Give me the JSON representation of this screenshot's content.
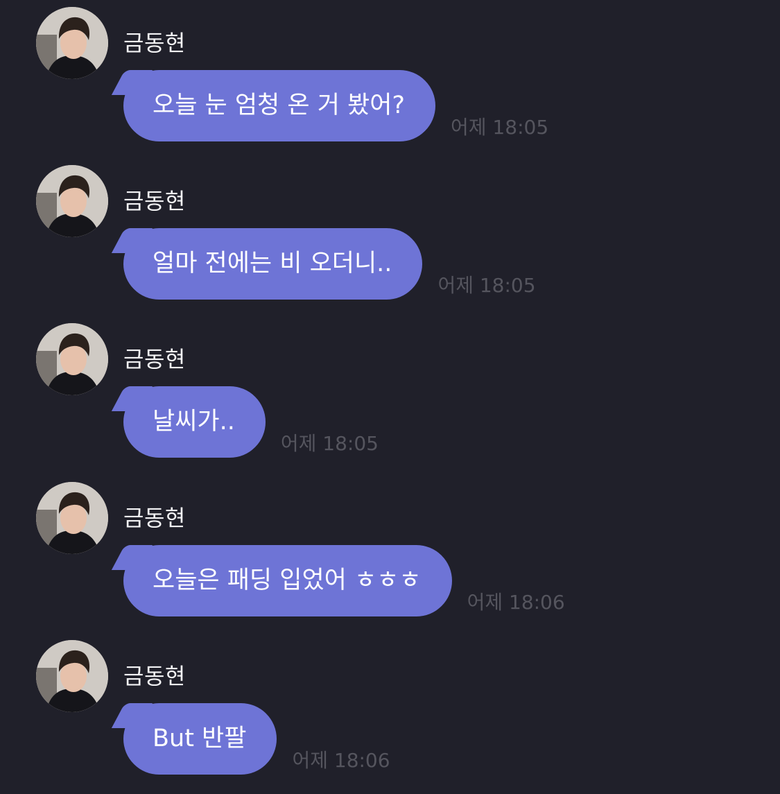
{
  "sender_name": "금동현",
  "messages": [
    {
      "text": "오늘 눈 엄청 온 거 봤어?",
      "time": "어제 18:05"
    },
    {
      "text": "얼마 전에는 비 오더니..",
      "time": "어제 18:05"
    },
    {
      "text": "날씨가..",
      "time": "어제 18:05"
    },
    {
      "text": "오늘은 패딩 입었어 ㅎㅎㅎ",
      "time": "어제 18:06"
    },
    {
      "text": "But 반팔",
      "time": "어제 18:06"
    }
  ],
  "colors": {
    "background": "#20202a",
    "bubble": "#6e74d6",
    "timestamp": "#55555e"
  },
  "icons": {
    "avatar": "profile-photo"
  }
}
